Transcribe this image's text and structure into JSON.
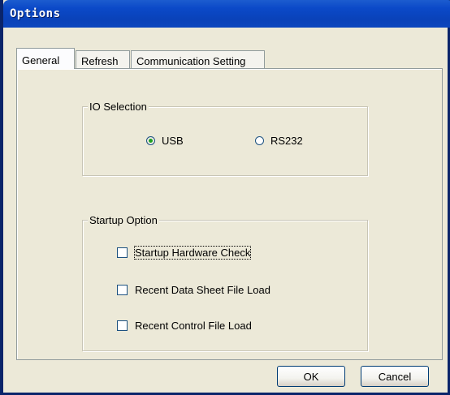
{
  "window": {
    "title": "Options"
  },
  "tabs": [
    {
      "label": "General",
      "active": true
    },
    {
      "label": "Refresh",
      "active": false
    },
    {
      "label": "Communication Setting",
      "active": false
    }
  ],
  "io_selection": {
    "legend": "IO Selection",
    "options": [
      {
        "label": "USB",
        "checked": true
      },
      {
        "label": "RS232",
        "checked": false
      }
    ]
  },
  "startup_option": {
    "legend": "Startup Option",
    "items": [
      {
        "label": "Startup Hardware Check",
        "checked": false
      },
      {
        "label": "Recent Data Sheet File Load",
        "checked": false
      },
      {
        "label": "Recent Control File Load",
        "checked": false
      }
    ]
  },
  "buttons": {
    "ok": "OK",
    "cancel": "Cancel"
  },
  "colors": {
    "title_bar": "#0a42b9",
    "dialog_bg": "#ece9d8",
    "radio_dot": "#21a121"
  }
}
